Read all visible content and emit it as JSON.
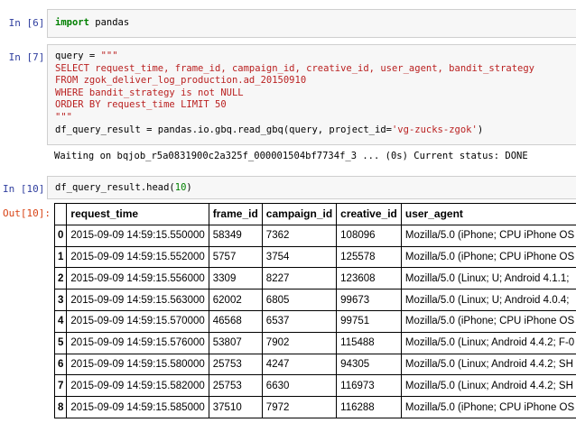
{
  "cells": {
    "c6": {
      "prompt": "In [6]:",
      "code_kw": "import",
      "code_rest": " pandas"
    },
    "c7": {
      "prompt": "In [7]:",
      "line1_var": "query = ",
      "line1_str": "\"\"\"",
      "sql": [
        "SELECT request_time, frame_id, campaign_id, creative_id, user_agent, bandit_strategy",
        "FROM zgok_deliver_log_production.ad_20150910",
        "WHERE bandit_strategy is not NULL",
        "ORDER BY request_time LIMIT 50",
        "\"\"\""
      ],
      "blank": "",
      "call_prefix": "df_query_result = pandas.io.gbq.read_gbq(query, project_id=",
      "call_str": "'vg-zucks-zgok'",
      "call_suffix": ")",
      "stream": "Waiting on bqjob_r5a0831900c2a325f_000001504bf7734f_3 ... (0s) Current status: DONE"
    },
    "c10": {
      "prompt": "In [10]:",
      "code_prefix": "df_query_result.head(",
      "code_num": "10",
      "code_suffix": ")",
      "out_prompt": "Out[10]:"
    }
  },
  "table": {
    "columns": [
      "",
      "request_time",
      "frame_id",
      "campaign_id",
      "creative_id",
      "user_agent"
    ],
    "rows": [
      [
        "0",
        "2015-09-09 14:59:15.550000",
        "58349",
        "7362",
        "108096",
        "Mozilla/5.0 (iPhone; CPU iPhone OS"
      ],
      [
        "1",
        "2015-09-09 14:59:15.552000",
        "5757",
        "3754",
        "125578",
        "Mozilla/5.0 (iPhone; CPU iPhone OS"
      ],
      [
        "2",
        "2015-09-09 14:59:15.556000",
        "3309",
        "8227",
        "123608",
        "Mozilla/5.0 (Linux; U; Android 4.1.1;"
      ],
      [
        "3",
        "2015-09-09 14:59:15.563000",
        "62002",
        "6805",
        "99673",
        "Mozilla/5.0 (Linux; U; Android 4.0.4;"
      ],
      [
        "4",
        "2015-09-09 14:59:15.570000",
        "46568",
        "6537",
        "99751",
        "Mozilla/5.0 (iPhone; CPU iPhone OS"
      ],
      [
        "5",
        "2015-09-09 14:59:15.576000",
        "53807",
        "7902",
        "115488",
        "Mozilla/5.0 (Linux; Android 4.4.2; F-0"
      ],
      [
        "6",
        "2015-09-09 14:59:15.580000",
        "25753",
        "4247",
        "94305",
        "Mozilla/5.0 (Linux; Android 4.4.2; SH"
      ],
      [
        "7",
        "2015-09-09 14:59:15.582000",
        "25753",
        "6630",
        "116973",
        "Mozilla/5.0 (Linux; Android 4.4.2; SH"
      ],
      [
        "8",
        "2015-09-09 14:59:15.585000",
        "37510",
        "7972",
        "116288",
        "Mozilla/5.0 (iPhone; CPU iPhone OS"
      ]
    ]
  }
}
